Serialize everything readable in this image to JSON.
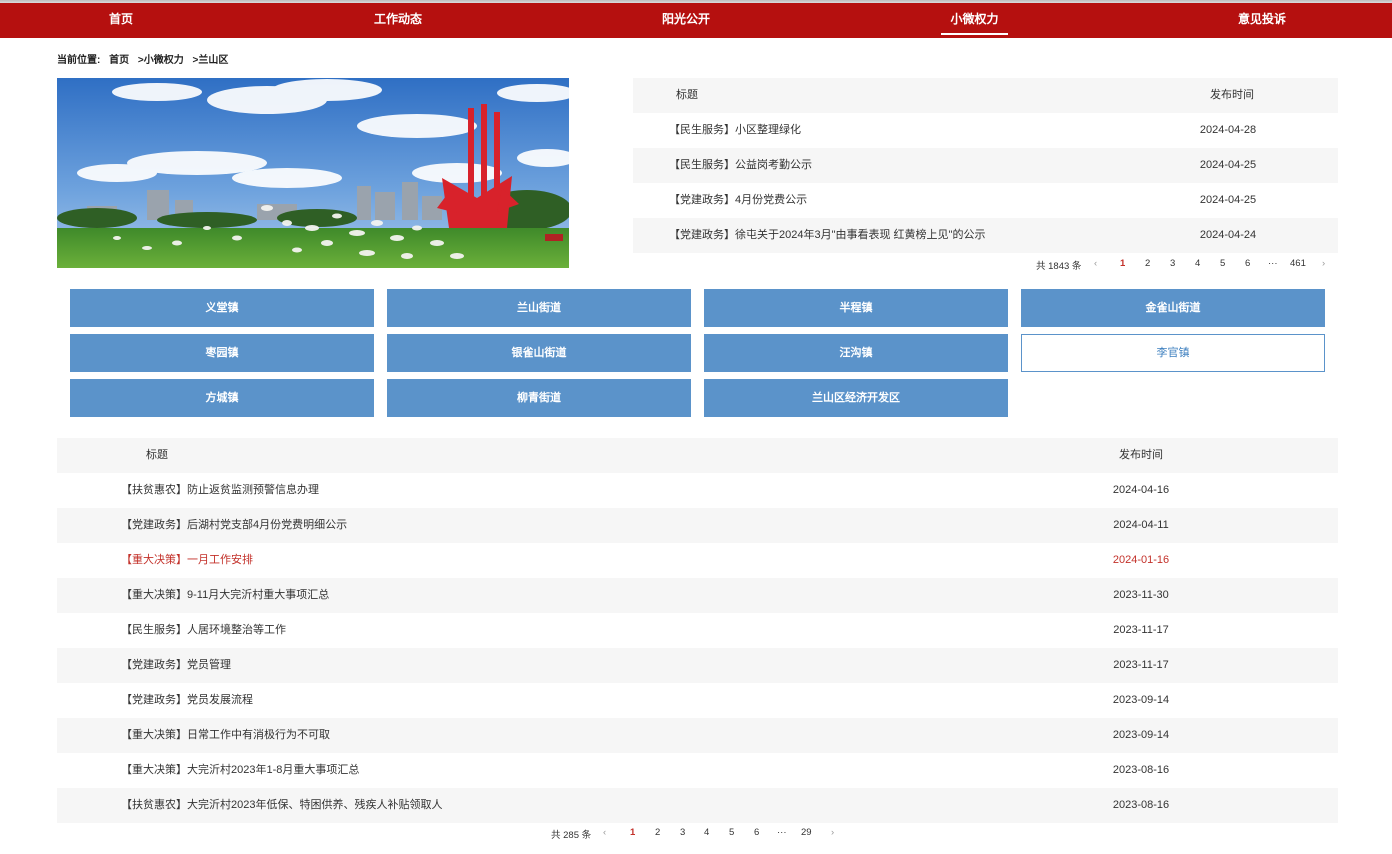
{
  "nav": {
    "items": [
      {
        "label": "首页"
      },
      {
        "label": "工作动态"
      },
      {
        "label": "阳光公开"
      },
      {
        "label": "小微权力"
      },
      {
        "label": "意见投诉"
      }
    ]
  },
  "breadcrumb": {
    "prefix": "当前位置:",
    "home": "首页",
    "level1": ">小微权力",
    "level2": ">兰山区"
  },
  "top_list": {
    "header_title": "标题",
    "header_date": "发布时间",
    "rows": [
      {
        "title": "【民生服务】小区整理绿化",
        "date": "2024-04-28"
      },
      {
        "title": "【民生服务】公益岗考勤公示",
        "date": "2024-04-25"
      },
      {
        "title": "【党建政务】4月份党费公示",
        "date": "2024-04-25"
      },
      {
        "title": "【党建政务】徐屯关于2024年3月\"由事看表现 红黄榜上见\"的公示",
        "date": "2024-04-24"
      }
    ],
    "pager": {
      "total": "共 1843 条",
      "prev": "‹",
      "pages": [
        "1",
        "2",
        "3",
        "4",
        "5",
        "6",
        "···",
        "461"
      ],
      "current": "1",
      "next": "›"
    }
  },
  "towns": {
    "items": [
      {
        "label": "义堂镇"
      },
      {
        "label": "兰山街道"
      },
      {
        "label": "半程镇"
      },
      {
        "label": "金雀山街道"
      },
      {
        "label": "枣园镇"
      },
      {
        "label": "银雀山街道"
      },
      {
        "label": "汪沟镇"
      },
      {
        "label": "李官镇"
      },
      {
        "label": "方城镇"
      },
      {
        "label": "柳青街道"
      },
      {
        "label": "兰山区经济开发区"
      }
    ],
    "selected": "李官镇"
  },
  "bottom_list": {
    "header_title": "标题",
    "header_date": "发布时间",
    "rows": [
      {
        "title": "【扶贫惠农】防止返贫监测预警信息办理",
        "date": "2024-04-16"
      },
      {
        "title": "【党建政务】后湖村党支部4月份党费明细公示",
        "date": "2024-04-11"
      },
      {
        "title": "【重大决策】一月工作安排",
        "date": "2024-01-16"
      },
      {
        "title": "【重大决策】9-11月大完沂村重大事项汇总",
        "date": "2023-11-30"
      },
      {
        "title": "【民生服务】人居环境整治等工作",
        "date": "2023-11-17"
      },
      {
        "title": "【党建政务】党员管理",
        "date": "2023-11-17"
      },
      {
        "title": "【党建政务】党员发展流程",
        "date": "2023-09-14"
      },
      {
        "title": "【重大决策】日常工作中有消极行为不可取",
        "date": "2023-09-14"
      },
      {
        "title": "【重大决策】大完沂村2023年1-8月重大事项汇总",
        "date": "2023-08-16"
      },
      {
        "title": "【扶贫惠农】大完沂村2023年低保、特困供养、残疾人补贴领取人",
        "date": "2023-08-16"
      }
    ],
    "highlighted_row": 2,
    "pager": {
      "total": "共 285 条",
      "prev": "‹",
      "pages": [
        "1",
        "2",
        "3",
        "4",
        "5",
        "6",
        "···",
        "29"
      ],
      "current": "1",
      "next": "›"
    }
  },
  "colors": {
    "nav_bg": "#b5100f",
    "town_button": "#5b93ca",
    "highlight_text": "#c3312a"
  }
}
